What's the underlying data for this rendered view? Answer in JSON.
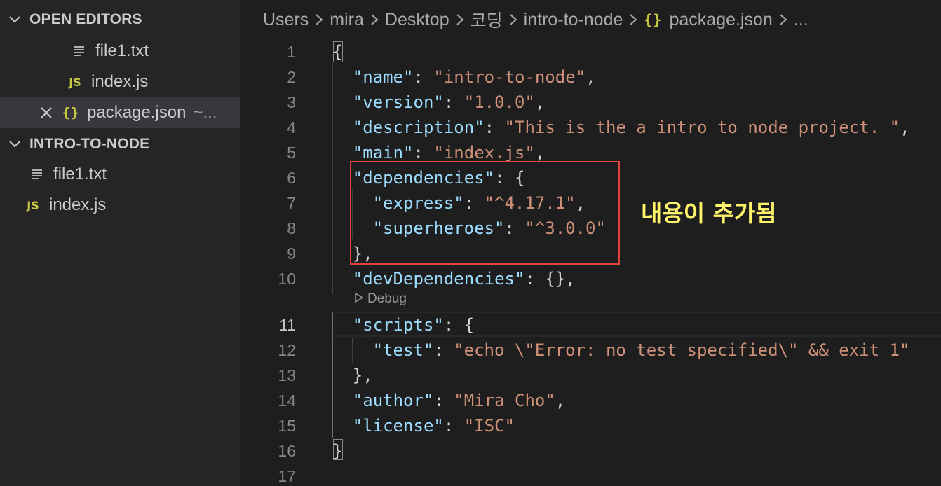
{
  "sidebar": {
    "open_editors": {
      "header": "OPEN EDITORS",
      "items": [
        {
          "name": "file1.txt",
          "icon": "file-text-icon"
        },
        {
          "name": "index.js",
          "icon": "js-icon"
        },
        {
          "name": "package.json",
          "icon": "json-icon",
          "suffix": "~..."
        }
      ]
    },
    "project": {
      "header": "INTRO-TO-NODE",
      "items": [
        {
          "name": "file1.txt",
          "icon": "file-text-icon"
        },
        {
          "name": "index.js",
          "icon": "js-icon"
        }
      ]
    }
  },
  "breadcrumb": [
    "Users",
    "mira",
    "Desktop",
    "코딩",
    "intro-to-node",
    "package.json",
    "..."
  ],
  "editor": {
    "line_numbers": [
      "1",
      "2",
      "3",
      "4",
      "5",
      "6",
      "7",
      "8",
      "9",
      "10",
      "11",
      "12",
      "13",
      "14",
      "15",
      "16",
      "17"
    ],
    "current_line": "11",
    "codelens": "Debug",
    "lines": [
      {
        "brace_open": "{"
      },
      {
        "key": "\"name\"",
        "value": "\"intro-to-node\"",
        "trail": ","
      },
      {
        "key": "\"version\"",
        "value": "\"1.0.0\"",
        "trail": ","
      },
      {
        "key": "\"description\"",
        "value": "\"This is the a intro to node project. \"",
        "trail": ","
      },
      {
        "key": "\"main\"",
        "value": "\"index.js\"",
        "trail": ","
      },
      {
        "key": "\"dependencies\"",
        "rest": ": {"
      },
      {
        "key": "\"express\"",
        "value": "\"^4.17.1\"",
        "trail": ","
      },
      {
        "key": "\"superheroes\"",
        "value": "\"^3.0.0\"",
        "trail": ""
      },
      {
        "plain": "},"
      },
      {
        "key": "\"devDependencies\"",
        "rest": ": {},"
      },
      {
        "key": "\"scripts\"",
        "rest": ": {"
      },
      {
        "key": "\"test\"",
        "value": "\"echo \\\"Error: no test specified\\\" && exit 1\"",
        "trail": ""
      },
      {
        "plain": "},"
      },
      {
        "key": "\"author\"",
        "value": "\"Mira Cho\"",
        "trail": ","
      },
      {
        "key": "\"license\"",
        "value": "\"ISC\"",
        "trail": ""
      },
      {
        "brace_close": "}"
      },
      {
        "plain": ""
      }
    ]
  },
  "annotation": {
    "text": "내용이 추가됨",
    "box_color": "#e0443a",
    "text_color": "#fff36b"
  },
  "colors": {
    "key": "#9cdcfe",
    "string": "#ce9178",
    "punct": "#d4d4d4",
    "json_icon": "#cbcb41"
  }
}
